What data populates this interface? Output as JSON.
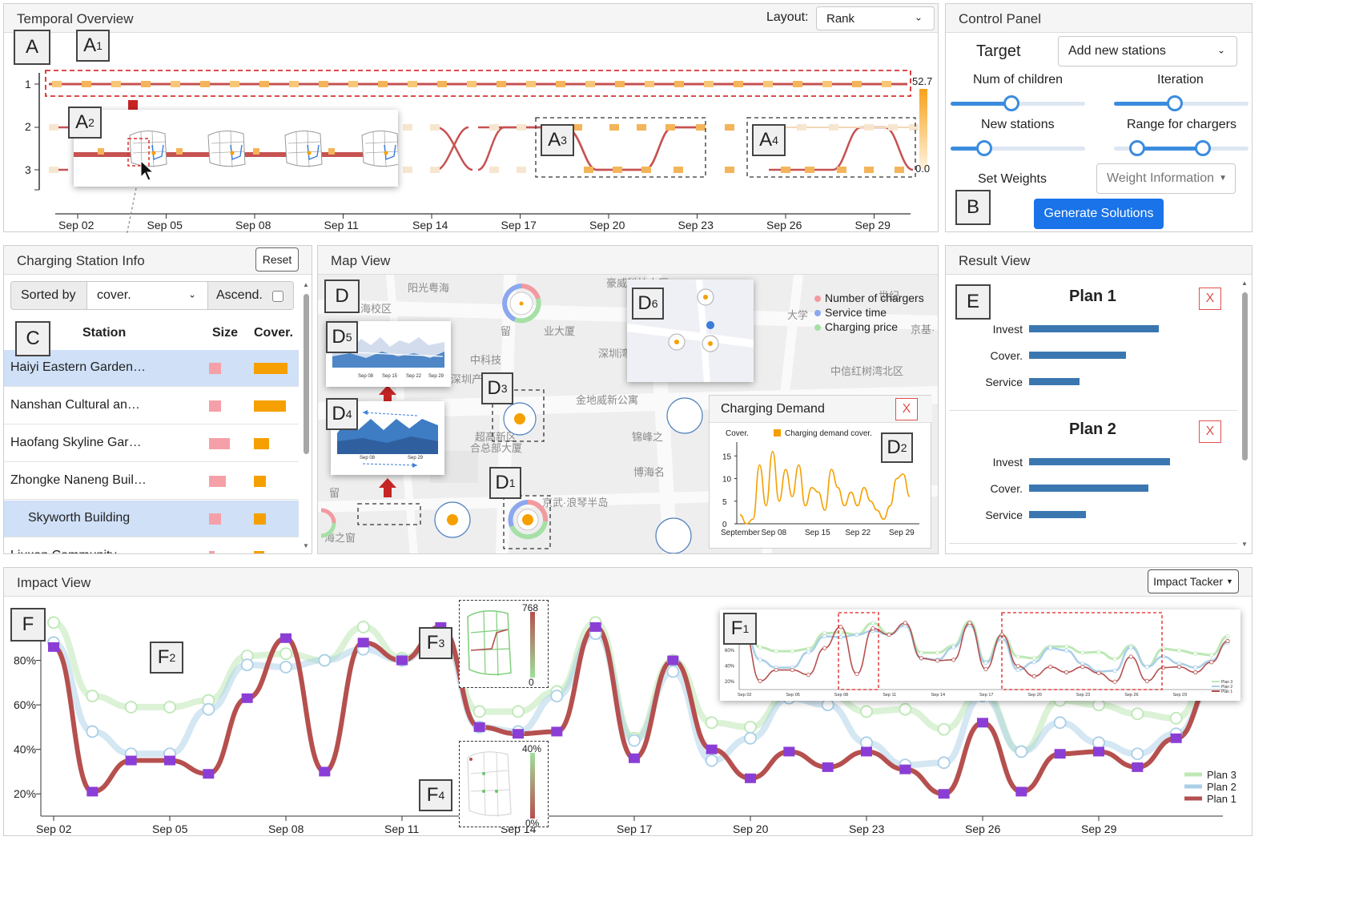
{
  "temporal": {
    "title": "Temporal Overview",
    "layout_label": "Layout:",
    "layout_value": "Rank",
    "rank_labels": [
      "1",
      "2",
      "3"
    ],
    "scale_max": "52.7",
    "scale_min": "0.0",
    "dates": [
      "Sep 02",
      "Sep 05",
      "Sep 08",
      "Sep 11",
      "Sep 14",
      "Sep 17",
      "Sep 20",
      "Sep 23",
      "Sep 26",
      "Sep 29"
    ]
  },
  "control": {
    "title": "Control Panel",
    "target_label": "Target",
    "target_value": "Add new stations",
    "num_children_label": "Num of children",
    "iteration_label": "Iteration",
    "new_stations_label": "New stations",
    "range_chargers_label": "Range for chargers",
    "set_weights_label": "Set Weights",
    "weight_info_label": "Weight Information",
    "generate_label": "Generate Solutions",
    "num_children": 0.45,
    "iteration": 0.45,
    "new_stations": 0.25,
    "range_low": 0.17,
    "range_high": 0.66
  },
  "station": {
    "title": "Charging Station Info",
    "reset_label": "Reset",
    "sorted_by_label": "Sorted by",
    "sorted_value": "cover.",
    "ascend_label": "Ascend.",
    "col_station": "Station",
    "col_size": "Size",
    "col_cover": "Cover.",
    "rows": [
      {
        "name": "Haiyi Eastern Garden…",
        "size": 0.5,
        "cover": 1.0
      },
      {
        "name": "Nanshan Cultural an…",
        "size": 0.5,
        "cover": 0.95
      },
      {
        "name": "Haofang Skyline Gar…",
        "size": 1.0,
        "cover": 0.45
      },
      {
        "name": "Zhongke Naneng Buil…",
        "size": 0.75,
        "cover": 0.35
      },
      {
        "name": "Skyworth Building",
        "size": 0.5,
        "cover": 0.35
      },
      {
        "name": "Liuxan Community",
        "size": 0.15,
        "cover": 0.3
      }
    ]
  },
  "map": {
    "title": "Map View",
    "place_labels": [
      "阳光粤海",
      "豪威科技大厦",
      "世纪",
      "粤海校区",
      "留",
      "业大厦",
      "深圳湾",
      "京基·",
      "中科技",
      "深圳产",
      "中信红树湾北区",
      "金地威新公寓",
      "超高新区",
      "合总部大厦",
      "锦峰之",
      "博海名",
      "京武·浪琴半岛",
      "海之窗",
      "大学",
      "留"
    ],
    "legend": [
      "Number of chargers",
      "Service time",
      "Charging price"
    ],
    "demand_title": "Charging Demand",
    "demand_ylabel": "Cover.",
    "demand_legend": "Charging demand cover.",
    "demand_yticks": [
      "15",
      "10",
      "5",
      "0"
    ],
    "demand_xticks": [
      "September",
      "Sep 08",
      "Sep 15",
      "Sep 22",
      "Sep 29"
    ],
    "demand_values": [
      2,
      0,
      1,
      13,
      4,
      16,
      5,
      12,
      6,
      13,
      4,
      8,
      7,
      3,
      12,
      8,
      4,
      7,
      4,
      8,
      5,
      3,
      1,
      4,
      10,
      11,
      6
    ]
  },
  "result": {
    "title": "Result View",
    "plans": [
      {
        "title": "Plan 1",
        "close": "X",
        "metrics": [
          {
            "label": "Invest",
            "value": 0.62
          },
          {
            "label": "Cover.",
            "value": 0.46
          },
          {
            "label": "Service",
            "value": 0.24
          }
        ]
      },
      {
        "title": "Plan 2",
        "close": "X",
        "metrics": [
          {
            "label": "Invest",
            "value": 0.67
          },
          {
            "label": "Cover.",
            "value": 0.57
          },
          {
            "label": "Service",
            "value": 0.27
          }
        ]
      }
    ]
  },
  "impact": {
    "title": "Impact View",
    "tracker_label": "Impact Tacker",
    "yticks": [
      "80%",
      "60%",
      "40%",
      "20%"
    ],
    "dates": [
      "Sep 02",
      "Sep 05",
      "Sep 08",
      "Sep 11",
      "Sep 14",
      "Sep 17",
      "Sep 20",
      "Sep 23",
      "Sep 26",
      "Sep 29"
    ],
    "legend": [
      "Plan 3",
      "Plan 2",
      "Plan 1"
    ],
    "colors": {
      "plan1": "#b5504f",
      "plan2": "#a9cfe8",
      "plan3": "#bde8b5"
    },
    "f3_max": "768",
    "f3_min": "0",
    "f4_max": "40%",
    "f4_min": "0%",
    "f1_yticks": [
      "80%",
      "60%",
      "40%",
      "20%"
    ],
    "f1_dates": [
      "Sep 02",
      "Sep 05",
      "Sep 08",
      "Sep 11",
      "Sep 14",
      "Sep 17",
      "Sep 20",
      "Sep 23",
      "Sep 26",
      "Sep 29"
    ],
    "f1_legend": [
      "Plan 3",
      "Plan 2",
      "Plan 1"
    ],
    "plan1": [
      86,
      21,
      35,
      35,
      29,
      63,
      90,
      30,
      88,
      80,
      95,
      50,
      47,
      48,
      95,
      36,
      80,
      40,
      27,
      39,
      32,
      39,
      31,
      20,
      52,
      21,
      38,
      39,
      32,
      45,
      72
    ],
    "plan2": [
      88,
      48,
      38,
      38,
      58,
      78,
      77,
      80,
      85,
      80,
      92,
      50,
      48,
      64,
      92,
      44,
      75,
      35,
      45,
      63,
      60,
      43,
      33,
      34,
      64,
      39,
      52,
      43,
      38,
      47,
      70
    ],
    "plan3": [
      97,
      64,
      59,
      59,
      62,
      82,
      83,
      80,
      95,
      81,
      92,
      57,
      57,
      66,
      97,
      45,
      80,
      52,
      50,
      65,
      65,
      57,
      58,
      49,
      66,
      39,
      62,
      60,
      56,
      54,
      78
    ]
  },
  "tags": {
    "A": "A",
    "A1": "A",
    "A2": "A",
    "A3": "A",
    "A4": "A",
    "B": "B",
    "C": "C",
    "D": "D",
    "D1": "D",
    "D2": "D",
    "D3": "D",
    "D4": "D",
    "D5": "D",
    "D6": "D",
    "E": "E",
    "F": "F",
    "F1": "F",
    "F2": "F",
    "F3": "F",
    "F4": "F",
    "sub1": "1",
    "sub2": "2",
    "sub3": "3",
    "sub4": "4",
    "sub5": "5",
    "sub6": "6"
  }
}
